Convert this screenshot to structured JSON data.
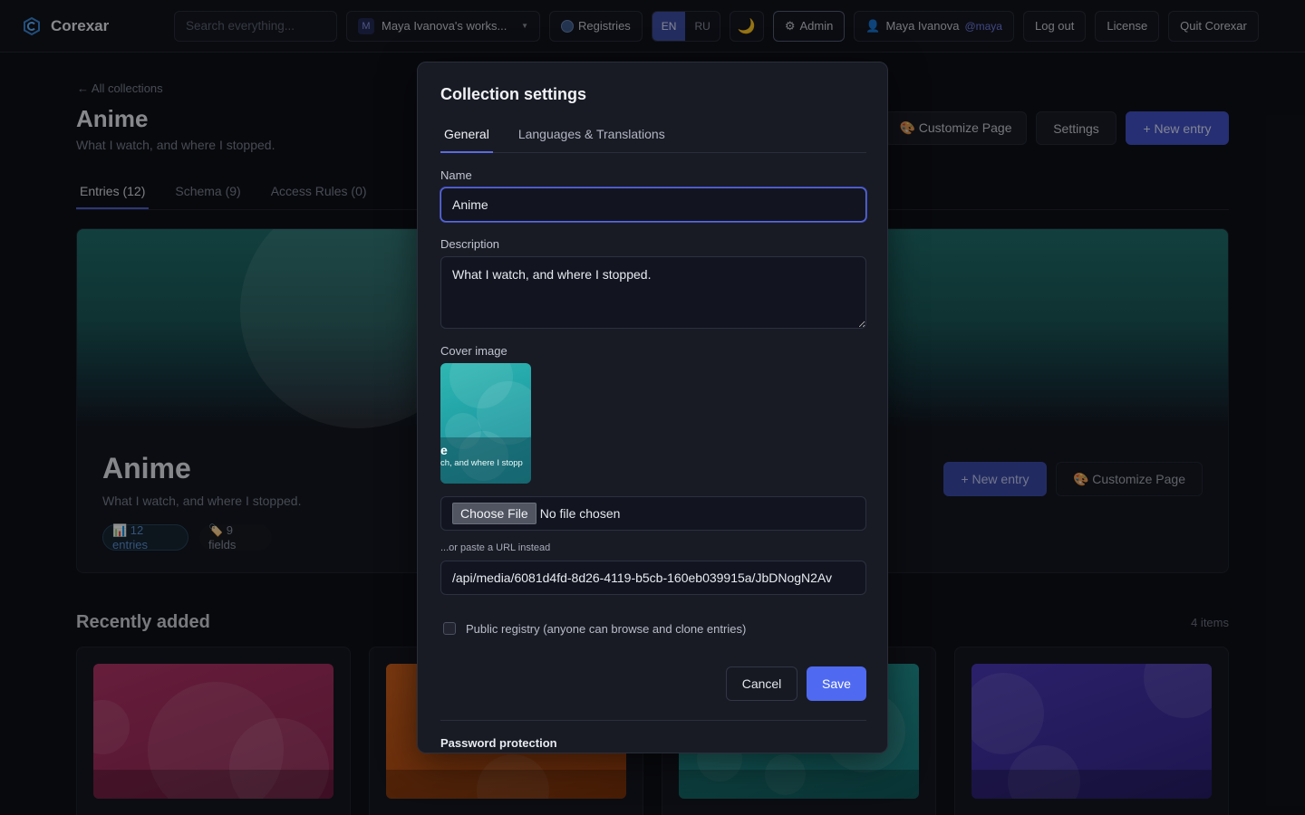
{
  "topbar": {
    "brand": "Corexar",
    "search_placeholder": "Search everything...",
    "workspace_initial": "M",
    "workspace_name": "Maya Ivanova's works...",
    "registries": "Registries",
    "lang_en": "EN",
    "lang_ru": "RU",
    "theme_icon": "moon-icon",
    "admin": "Admin",
    "user_name": "Maya Ivanova",
    "user_handle": "@maya",
    "logout": "Log out",
    "license": "License",
    "quit": "Quit Corexar"
  },
  "page": {
    "back_link": "← All collections",
    "title": "Anime",
    "description": "What I watch, and where I stopped.",
    "tabs": [
      "Entries (12)",
      "Schema (9)",
      "Access Rules (0)"
    ],
    "customize_btn": "🎨 Customize Page",
    "settings_btn": "Settings",
    "new_entry_btn": "+ New entry"
  },
  "hero": {
    "title": "Anime",
    "description": "What I watch, and where I stopped.",
    "entries_chip": "📊 12 entries",
    "fields_chip": "🏷️ 9 fields",
    "new_entry_btn": "+ New entry",
    "customize_btn": "🎨 Customize Page"
  },
  "recent": {
    "title": "Recently added",
    "count": "4 items",
    "card_colors": [
      "#a02a5e",
      "#c0561a",
      "#1f8d8f",
      "#3b2f9e"
    ]
  },
  "modal": {
    "title": "Collection settings",
    "tabs": [
      "General",
      "Languages & Translations"
    ],
    "name_label": "Name",
    "name_value": "Anime",
    "description_label": "Description",
    "description_value": "What I watch, and where I stopped.",
    "cover_label": "Cover image",
    "cover_text_title": "e",
    "cover_text_desc": "ch, and where I stopp",
    "choose_file": "Choose File",
    "no_file": "No file chosen",
    "url_note": "...or paste a URL instead",
    "url_value": "/api/media/6081d4fd-8d26-4119-b5cb-160eb039915a/JbDNogN2Av",
    "public_label": "Public registry (anyone can browse and clone entries)",
    "cancel": "Cancel",
    "save": "Save",
    "password_section": "Password protection"
  },
  "colors": {
    "accent": "#4f6af0",
    "background": "#0f1117",
    "modal_bg": "#181b24"
  }
}
